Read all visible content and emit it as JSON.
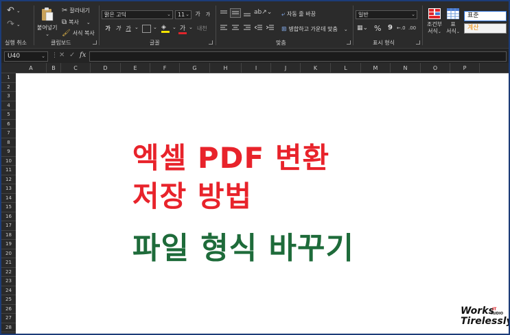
{
  "ribbon": {
    "undo_label": "실행 취소",
    "clipboard": {
      "paste_label": "붙여넣기",
      "cut_label": "잘라내기",
      "copy_label": "복사",
      "format_painter_label": "서식 복사",
      "group_label": "클립보드"
    },
    "font": {
      "font_name": "맑은 고딕",
      "font_size": "11",
      "grow_label": "가",
      "shrink_label": "가",
      "bold_label": "가",
      "italic_label": "가",
      "underline_label": "가",
      "font_color_label": "가",
      "group_label": "글꼴"
    },
    "alignment": {
      "wrap_label": "자동 줄 바꿈",
      "merge_label": "병합하고 가운데 맞춤",
      "group_label": "맞춤"
    },
    "number": {
      "format_value": "일반",
      "percent_label": "%",
      "comma_label": "9",
      "group_label": "표시 형식"
    },
    "styles": {
      "conditional_label_1": "조건부",
      "conditional_label_2": "서식",
      "table_label_1": "표",
      "table_label_2": "서식",
      "style_normal": "표준",
      "style_calc": "계산"
    }
  },
  "formula_bar": {
    "name_box": "U40",
    "fx_label": "fx",
    "formula_value": ""
  },
  "grid": {
    "columns": [
      "A",
      "B",
      "C",
      "D",
      "E",
      "F",
      "G",
      "H",
      "I",
      "J",
      "K",
      "L",
      "M",
      "N",
      "O",
      "P"
    ],
    "rows": [
      "1",
      "2",
      "3",
      "4",
      "5",
      "6",
      "7",
      "8",
      "9",
      "10",
      "11",
      "12",
      "13",
      "14",
      "15",
      "16",
      "17",
      "18",
      "19",
      "20",
      "21",
      "22",
      "23",
      "24",
      "25",
      "26",
      "27",
      "28"
    ]
  },
  "content": {
    "line1": "엑셀 PDF 변환",
    "line2": "저장 방법",
    "line3": "파일 형식 바꾸기",
    "line1_color": "#e8232b",
    "line2_color": "#e8232b",
    "line3_color": "#1e6b3a"
  },
  "watermark": {
    "word1": "Works",
    "word2": "Tirelessly",
    "tag_it": "IT",
    "tag_audio": "AUDIO"
  }
}
